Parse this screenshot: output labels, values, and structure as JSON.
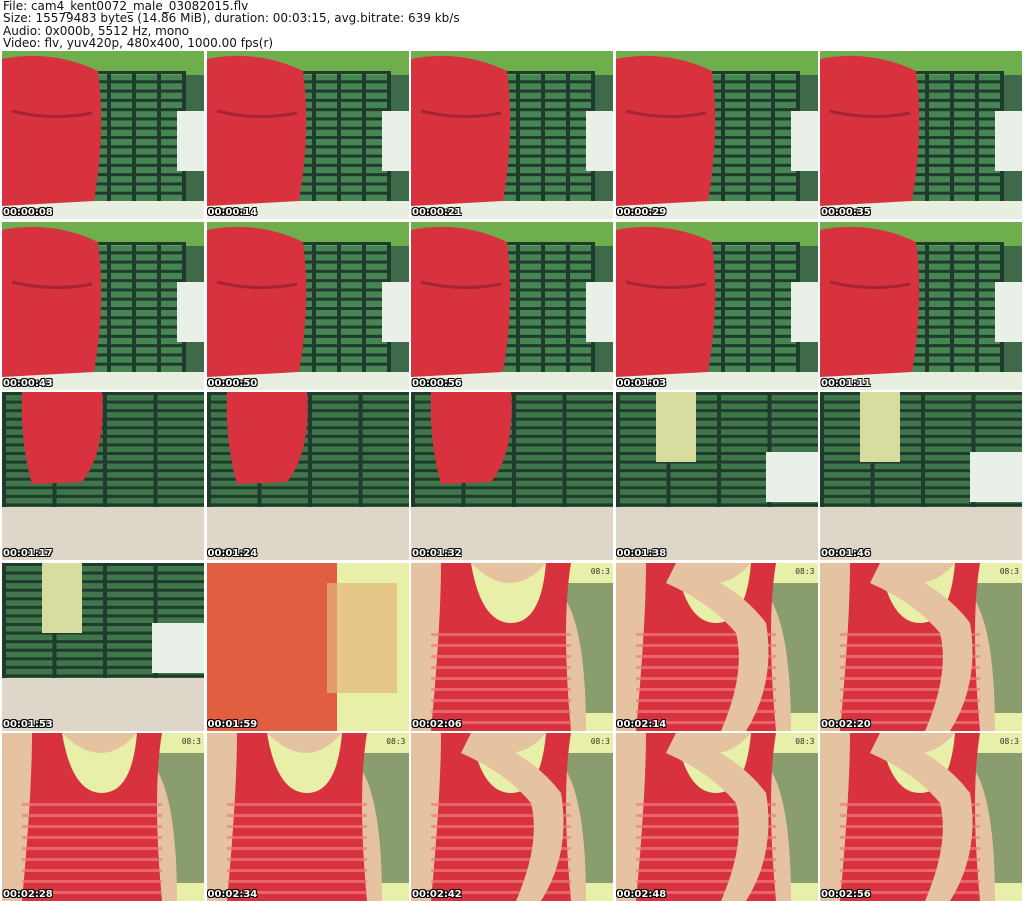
{
  "header": {
    "file": "File: cam4_kent0072_male_03082015.flv",
    "size": "Size: 15579483 bytes (14.86 MiB), duration: 00:03:15, avg.bitrate: 639 kb/s",
    "audio": "Audio: 0x000b, 5512 Hz, mono",
    "video": "Video: flv, yuv420p, 480x400, 1000.00 fps(r)"
  },
  "thumbnails": [
    {
      "time": "00:00:08",
      "scene": "shirt-on-rack"
    },
    {
      "time": "00:00:14",
      "scene": "shirt-on-rack"
    },
    {
      "time": "00:00:21",
      "scene": "shirt-on-rack"
    },
    {
      "time": "00:00:29",
      "scene": "shirt-on-rack"
    },
    {
      "time": "00:00:35",
      "scene": "shirt-on-rack"
    },
    {
      "time": "00:00:43",
      "scene": "shirt-on-rack"
    },
    {
      "time": "00:00:50",
      "scene": "shirt-on-rack"
    },
    {
      "time": "00:00:56",
      "scene": "shirt-on-rack"
    },
    {
      "time": "00:01:03",
      "scene": "shirt-on-rack"
    },
    {
      "time": "00:01:11",
      "scene": "shirt-on-rack"
    },
    {
      "time": "00:01:17",
      "scene": "shirt-low"
    },
    {
      "time": "00:01:24",
      "scene": "shirt-low"
    },
    {
      "time": "00:01:32",
      "scene": "shirt-low"
    },
    {
      "time": "00:01:38",
      "scene": "rack-empty"
    },
    {
      "time": "00:01:46",
      "scene": "rack-empty"
    },
    {
      "time": "00:01:53",
      "scene": "rack-empty"
    },
    {
      "time": "00:01:59",
      "scene": "blur-red"
    },
    {
      "time": "00:02:06",
      "scene": "tank-top",
      "clock": "08:3"
    },
    {
      "time": "00:02:14",
      "scene": "tank-top-hand",
      "clock": "08:3"
    },
    {
      "time": "00:02:20",
      "scene": "tank-top-hand",
      "clock": "08:3"
    },
    {
      "time": "00:02:28",
      "scene": "tank-top",
      "clock": "08:3"
    },
    {
      "time": "00:02:34",
      "scene": "tank-top",
      "clock": "08:3"
    },
    {
      "time": "00:02:42",
      "scene": "tank-top-hand",
      "clock": "08:3"
    },
    {
      "time": "00:02:48",
      "scene": "tank-top-hand",
      "clock": "08:3"
    },
    {
      "time": "00:02:56",
      "scene": "tank-top-hand",
      "clock": "08:3"
    }
  ],
  "colors": {
    "shirt_red": "#d8323f",
    "rack_dark": "#1f3b2d",
    "wall_green": "#4e9b5a",
    "skin": "#e6c3a0",
    "cloth_white": "#e8f0e8",
    "yellow_bg": "#e8efa8"
  }
}
